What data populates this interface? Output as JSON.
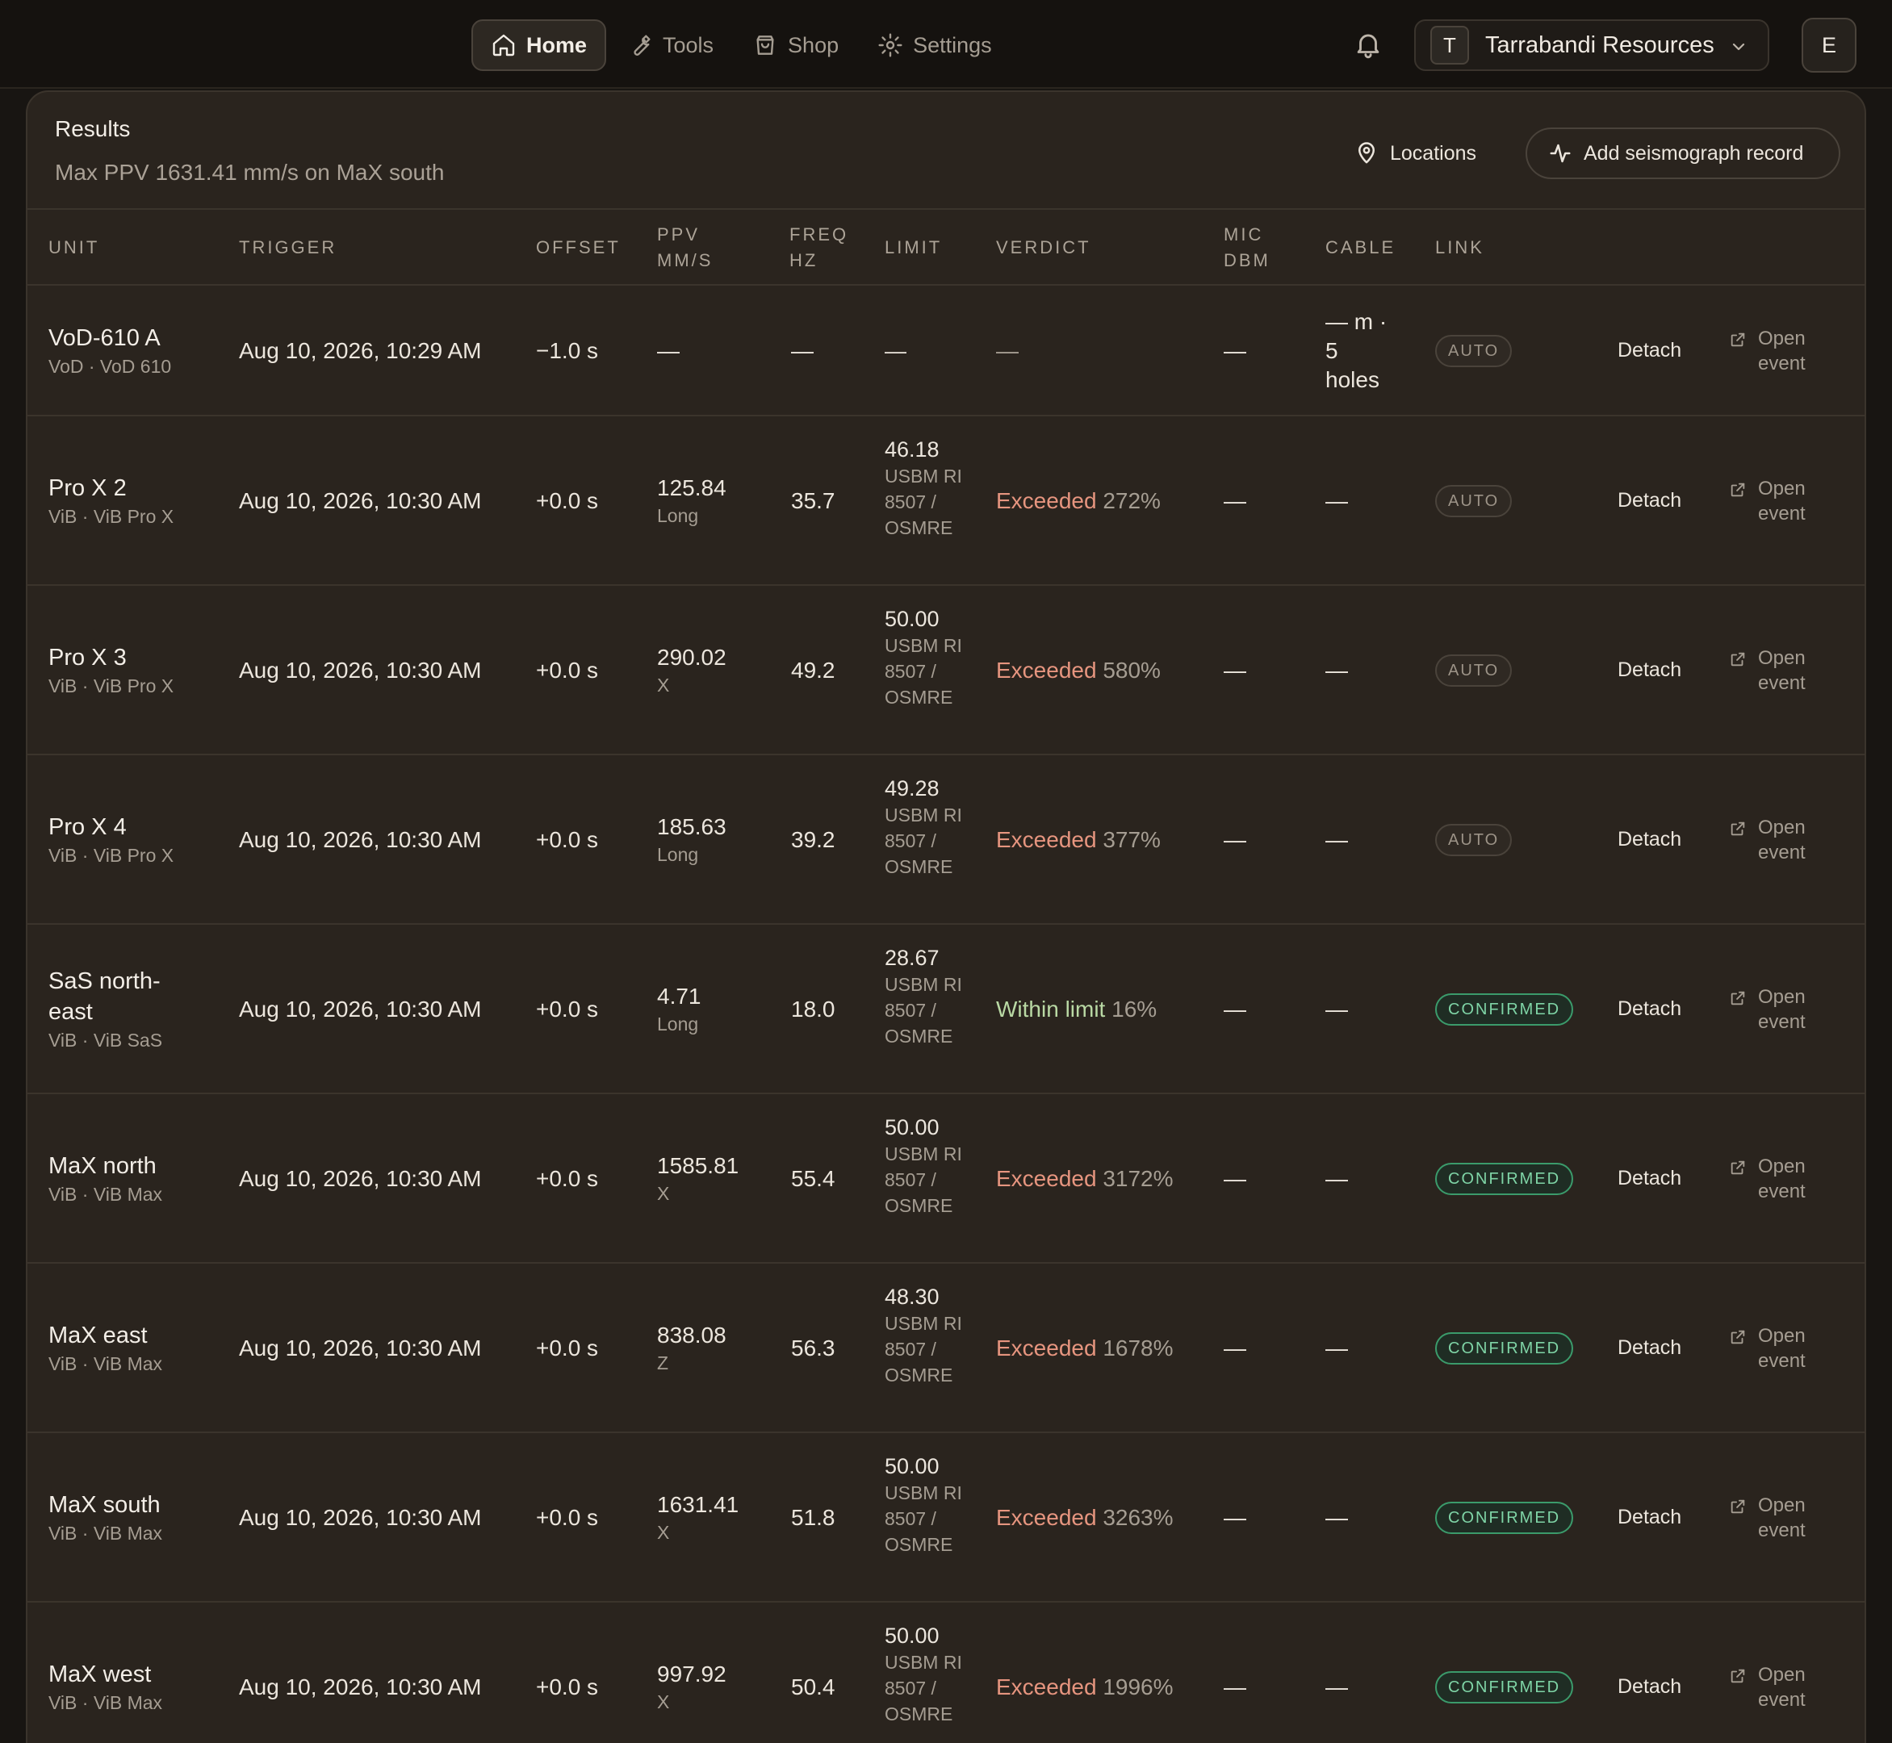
{
  "nav": {
    "items": [
      {
        "label": "Home",
        "active": true
      },
      {
        "label": "Tools",
        "active": false
      },
      {
        "label": "Shop",
        "active": false
      },
      {
        "label": "Settings",
        "active": false
      }
    ]
  },
  "org": {
    "initial": "T",
    "name": "Tarrabandi Resources"
  },
  "user": {
    "initial": "E"
  },
  "panel": {
    "title": "Results",
    "subtitle": "Max PPV 1631.41 mm/s on MaX south",
    "locations_label": "Locations",
    "add_label": "Add seismograph record"
  },
  "columns": {
    "unit": "UNIT",
    "trigger": "TRIGGER",
    "offset": "OFFSET",
    "ppv_1": "PPV",
    "ppv_2": "MM/S",
    "freq_1": "FREQ",
    "freq_2": "HZ",
    "limit": "LIMIT",
    "verdict": "VERDICT",
    "mic_1": "MIC",
    "mic_2": "DBM",
    "cable": "CABLE",
    "link": "LINK"
  },
  "row_actions": {
    "detach": "Detach",
    "open_1": "Open",
    "open_2": "event"
  },
  "rows": [
    {
      "unit": "VoD-610 A",
      "unit_line2": "",
      "sub": "VoD · VoD 610",
      "trigger": "Aug 10, 2026, 10:29 AM",
      "offset": "−1.0 s",
      "ppv": "—",
      "ppv_axis": "",
      "freq": "—",
      "limit_val": "—",
      "limit_std": "",
      "verdict_word": "",
      "verdict_pct": "—",
      "verdict_type": "none",
      "mic": "—",
      "cable_1": "— m ·",
      "cable_2": "5",
      "cable_3": "holes",
      "link": "AUTO",
      "link_type": "auto"
    },
    {
      "unit": "Pro X 2",
      "unit_line2": "",
      "sub": "ViB · ViB Pro X",
      "trigger": "Aug 10, 2026, 10:30 AM",
      "offset": "+0.0 s",
      "ppv": "125.84",
      "ppv_axis": "Long",
      "freq": "35.7",
      "limit_val": "46.18",
      "limit_std": "USBM RI 8507 / OSMRE",
      "verdict_word": "Exceeded",
      "verdict_pct": "272%",
      "verdict_type": "exceeded",
      "mic": "—",
      "cable_1": "—",
      "cable_2": "",
      "cable_3": "",
      "link": "AUTO",
      "link_type": "auto"
    },
    {
      "unit": "Pro X 3",
      "unit_line2": "",
      "sub": "ViB · ViB Pro X",
      "trigger": "Aug 10, 2026, 10:30 AM",
      "offset": "+0.0 s",
      "ppv": "290.02",
      "ppv_axis": "X",
      "freq": "49.2",
      "limit_val": "50.00",
      "limit_std": "USBM RI 8507 / OSMRE",
      "verdict_word": "Exceeded",
      "verdict_pct": "580%",
      "verdict_type": "exceeded",
      "mic": "—",
      "cable_1": "—",
      "cable_2": "",
      "cable_3": "",
      "link": "AUTO",
      "link_type": "auto"
    },
    {
      "unit": "Pro X 4",
      "unit_line2": "",
      "sub": "ViB · ViB Pro X",
      "trigger": "Aug 10, 2026, 10:30 AM",
      "offset": "+0.0 s",
      "ppv": "185.63",
      "ppv_axis": "Long",
      "freq": "39.2",
      "limit_val": "49.28",
      "limit_std": "USBM RI 8507 / OSMRE",
      "verdict_word": "Exceeded",
      "verdict_pct": "377%",
      "verdict_type": "exceeded",
      "mic": "—",
      "cable_1": "—",
      "cable_2": "",
      "cable_3": "",
      "link": "AUTO",
      "link_type": "auto"
    },
    {
      "unit": "SaS north-",
      "unit_line2": "east",
      "sub": "ViB · ViB SaS",
      "trigger": "Aug 10, 2026, 10:30 AM",
      "offset": "+0.0 s",
      "ppv": "4.71",
      "ppv_axis": "Long",
      "freq": "18.0",
      "limit_val": "28.67",
      "limit_std": "USBM RI 8507 / OSMRE",
      "verdict_word": "Within limit",
      "verdict_pct": "16%",
      "verdict_type": "ok",
      "mic": "—",
      "cable_1": "—",
      "cable_2": "",
      "cable_3": "",
      "link": "CONFIRMED",
      "link_type": "confirmed"
    },
    {
      "unit": "MaX north",
      "unit_line2": "",
      "sub": "ViB · ViB Max",
      "trigger": "Aug 10, 2026, 10:30 AM",
      "offset": "+0.0 s",
      "ppv": "1585.81",
      "ppv_axis": "X",
      "freq": "55.4",
      "limit_val": "50.00",
      "limit_std": "USBM RI 8507 / OSMRE",
      "verdict_word": "Exceeded",
      "verdict_pct": "3172%",
      "verdict_type": "exceeded",
      "mic": "—",
      "cable_1": "—",
      "cable_2": "",
      "cable_3": "",
      "link": "CONFIRMED",
      "link_type": "confirmed"
    },
    {
      "unit": "MaX east",
      "unit_line2": "",
      "sub": "ViB · ViB Max",
      "trigger": "Aug 10, 2026, 10:30 AM",
      "offset": "+0.0 s",
      "ppv": "838.08",
      "ppv_axis": "Z",
      "freq": "56.3",
      "limit_val": "48.30",
      "limit_std": "USBM RI 8507 / OSMRE",
      "verdict_word": "Exceeded",
      "verdict_pct": "1678%",
      "verdict_type": "exceeded",
      "mic": "—",
      "cable_1": "—",
      "cable_2": "",
      "cable_3": "",
      "link": "CONFIRMED",
      "link_type": "confirmed"
    },
    {
      "unit": "MaX south",
      "unit_line2": "",
      "sub": "ViB · ViB Max",
      "trigger": "Aug 10, 2026, 10:30 AM",
      "offset": "+0.0 s",
      "ppv": "1631.41",
      "ppv_axis": "X",
      "freq": "51.8",
      "limit_val": "50.00",
      "limit_std": "USBM RI 8507 / OSMRE",
      "verdict_word": "Exceeded",
      "verdict_pct": "3263%",
      "verdict_type": "exceeded",
      "mic": "—",
      "cable_1": "—",
      "cable_2": "",
      "cable_3": "",
      "link": "CONFIRMED",
      "link_type": "confirmed"
    },
    {
      "unit": "MaX west",
      "unit_line2": "",
      "sub": "ViB · ViB Max",
      "trigger": "Aug 10, 2026, 10:30 AM",
      "offset": "+0.0 s",
      "ppv": "997.92",
      "ppv_axis": "X",
      "freq": "50.4",
      "limit_val": "50.00",
      "limit_std": "USBM RI 8507 / OSMRE",
      "verdict_word": "Exceeded",
      "verdict_pct": "1996%",
      "verdict_type": "exceeded",
      "mic": "—",
      "cable_1": "—",
      "cable_2": "",
      "cable_3": "",
      "link": "CONFIRMED",
      "link_type": "confirmed"
    }
  ],
  "colors": {
    "exceeded": "#e6957f",
    "within_limit": "#b9d9a4",
    "confirmed": "#7fd4a6",
    "background": "#181512",
    "panel": "#2a241e"
  },
  "icons": {
    "home": "home-icon",
    "tools": "wrench-icon",
    "shop": "shopping-bag-icon",
    "settings": "gear-icon",
    "bell": "bell-icon",
    "chevron": "chevron-down-icon",
    "locations": "map-pin-icon",
    "add": "activity-icon",
    "open": "external-link-icon"
  }
}
